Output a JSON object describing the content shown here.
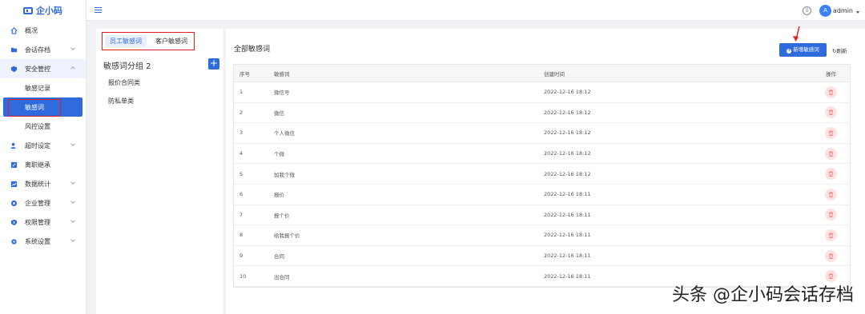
{
  "app": {
    "logo_text": "企小码"
  },
  "sidebar": {
    "items": [
      {
        "label": "概况",
        "icon": "home-icon"
      },
      {
        "label": "会话存档",
        "icon": "folder-icon",
        "chevron": "down"
      },
      {
        "label": "安全管控",
        "icon": "shield-icon",
        "chevron": "up",
        "open": true
      },
      {
        "label": "超时设定",
        "icon": "user-clock-icon",
        "chevron": "down"
      },
      {
        "label": "离职继承",
        "icon": "handover-icon"
      },
      {
        "label": "数据统计",
        "icon": "chart-icon",
        "chevron": "down"
      },
      {
        "label": "企业管理",
        "icon": "building-icon",
        "chevron": "down"
      },
      {
        "label": "权限管理",
        "icon": "lock-icon",
        "chevron": "down"
      },
      {
        "label": "系统设置",
        "icon": "gear-icon",
        "chevron": "down"
      }
    ],
    "sub_items": [
      {
        "label": "敏感记录"
      },
      {
        "label": "敏感词",
        "active": true
      },
      {
        "label": "风控设置"
      }
    ]
  },
  "topbar": {
    "username": "admin",
    "avatar_letter": "A"
  },
  "left_panel": {
    "tabs": [
      {
        "label": "员工敏感词",
        "active": true
      },
      {
        "label": "客户敏感词"
      }
    ],
    "group_title": "敏感词分组 2",
    "add_label": "+",
    "groups": [
      {
        "label": "报价合同类"
      },
      {
        "label": "防私单类"
      }
    ]
  },
  "main": {
    "title": "全部敏感词",
    "new_button_label": "新增敏感词",
    "refresh_label": "刷新",
    "columns": {
      "index": "序号",
      "word": "敏感词",
      "created": "创建时间",
      "op": "操作"
    },
    "rows": [
      {
        "index": "1",
        "word": "微信号",
        "created": "2022-12-16 18:12"
      },
      {
        "index": "2",
        "word": "微信",
        "created": "2022-12-16 18:12"
      },
      {
        "index": "3",
        "word": "个人微信",
        "created": "2022-12-16 18:12"
      },
      {
        "index": "4",
        "word": "个微",
        "created": "2022-12-16 18:12"
      },
      {
        "index": "5",
        "word": "加我个微",
        "created": "2022-12-16 18:12"
      },
      {
        "index": "6",
        "word": "报价",
        "created": "2022-12-16 18:11"
      },
      {
        "index": "7",
        "word": "报个价",
        "created": "2022-12-16 18:11"
      },
      {
        "index": "8",
        "word": "给我报个价",
        "created": "2022-12-16 18:11"
      },
      {
        "index": "9",
        "word": "合同",
        "created": "2022-12-16 18:11"
      },
      {
        "index": "10",
        "word": "出合同",
        "created": "2022-12-16 18:11"
      }
    ]
  },
  "watermark": "头条 @企小码会话存档",
  "colors": {
    "accent": "#2f6bdc",
    "highlight_box": "#e02020",
    "danger_bg": "#fde2e2",
    "danger": "#f56c6c"
  }
}
